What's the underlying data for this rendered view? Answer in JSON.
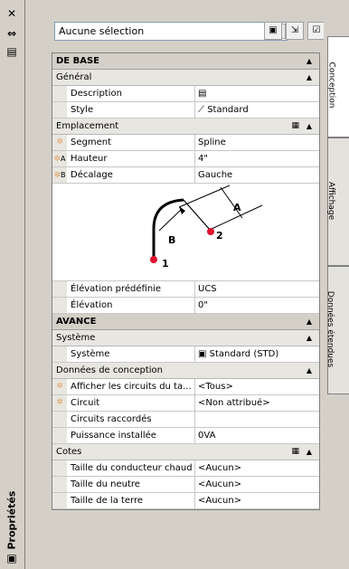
{
  "toolbar": {
    "selection_value": "Aucune sélection"
  },
  "sections": {
    "base": {
      "title": "DE BASE"
    },
    "general": {
      "title": "Général"
    },
    "emplacement": {
      "title": "Emplacement"
    },
    "avance": {
      "title": "AVANCE"
    },
    "systeme": {
      "title": "Système"
    },
    "donnees": {
      "title": "Données de conception"
    },
    "cotes": {
      "title": "Cotes"
    }
  },
  "props": {
    "description": {
      "name": "Description",
      "value": ""
    },
    "style": {
      "name": "Style",
      "value": "Standard"
    },
    "segment": {
      "name": "Segment",
      "value": "Spline"
    },
    "hauteur": {
      "name": "Hauteur",
      "value": "4\"",
      "gutter": "A"
    },
    "decalage": {
      "name": "Décalage",
      "value": "Gauche",
      "gutter": "B"
    },
    "elevation_pre": {
      "name": "Élévation prédéfinie",
      "value": "UCS"
    },
    "elevation": {
      "name": "Élévation",
      "value": "0\""
    },
    "systeme": {
      "name": "Système",
      "value": "Standard (STD)"
    },
    "afficher": {
      "name": "Afficher les circuits du ta...",
      "value": "<Tous>"
    },
    "circuit": {
      "name": "Circuit",
      "value": "<Non attribué>"
    },
    "raccordes": {
      "name": "Circuits raccordés",
      "value": ""
    },
    "puissance": {
      "name": "Puissance installée",
      "value": "0VA"
    },
    "taille_chaud": {
      "name": "Taille du conducteur chaud",
      "value": "<Aucun>"
    },
    "taille_neutre": {
      "name": "Taille du neutre",
      "value": "<Aucun>"
    },
    "taille_terre": {
      "name": "Taille de la terre",
      "value": "<Aucun>"
    }
  },
  "diagram": {
    "label_a": "A",
    "label_b": "B",
    "label_1": "1",
    "label_2": "2"
  },
  "palette": {
    "title": "Propriétés"
  },
  "right_tabs": {
    "tab1": "Conception",
    "tab2": "Affichage",
    "tab3": "Données étendues"
  },
  "colors": {
    "grip": "#e0102a",
    "accent": "#0a246a"
  }
}
